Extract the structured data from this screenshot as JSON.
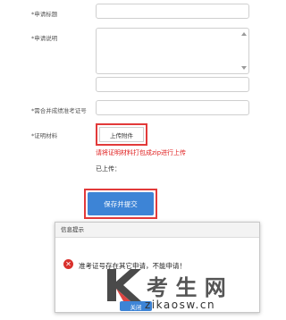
{
  "form": {
    "title_label": "*申请标题",
    "desc_label": "*申请说明",
    "exam_no_label": "*需合并成绩准考证号",
    "material_label": "*证明材料",
    "upload_label": "上传附件",
    "zip_hint": "请将证明材料打包成zip进行上传",
    "uploaded_label": "已上传：",
    "submit_label": "保存并提交"
  },
  "dialog": {
    "title": "信息提示",
    "icon": "error-icon",
    "message": "准考证号存在其它申请，不能申请！",
    "ok_label": "关闭"
  },
  "watermark": {
    "logo_letter": "K",
    "text": "考 生 网",
    "url": "zikaosw.cn"
  },
  "colors": {
    "accent": "#3d84d6",
    "highlight_border": "#e23a3a",
    "hint_text": "#e02020",
    "error_icon": "#d9302c"
  }
}
